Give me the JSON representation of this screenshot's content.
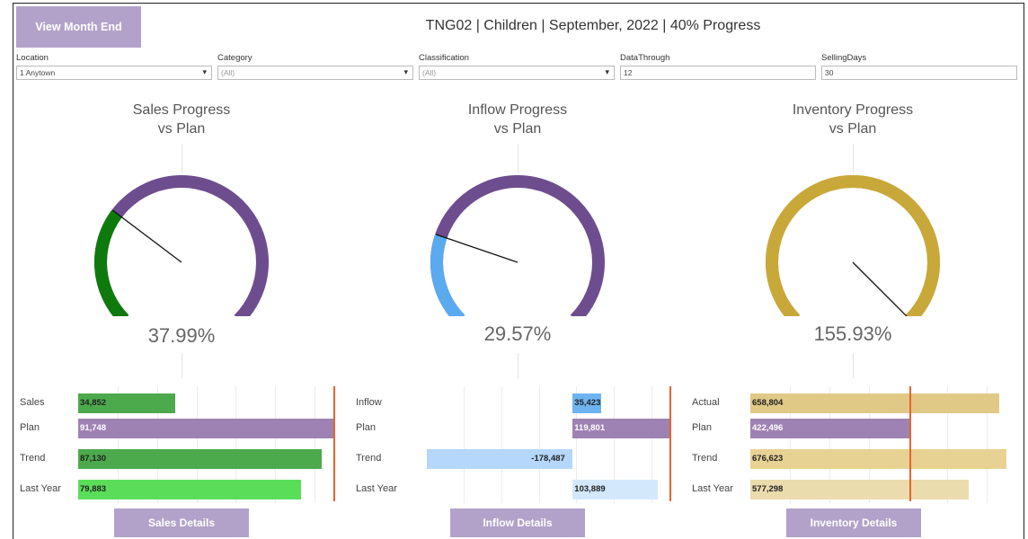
{
  "header": {
    "view_button": "View Month End",
    "title": "TNG02 | Children | September, 2022 | 40% Progress"
  },
  "filters": [
    {
      "label": "Location",
      "value": "1 Anytown",
      "type": "dropdown"
    },
    {
      "label": "Category",
      "value": "(All)",
      "type": "dropdown"
    },
    {
      "label": "Classification",
      "value": "(All)",
      "type": "dropdown"
    },
    {
      "label": "DataThrough",
      "value": "12",
      "type": "text"
    },
    {
      "label": "SellingDays",
      "value": "30",
      "type": "text"
    }
  ],
  "gauges": [
    {
      "title1": "Sales Progress",
      "title2": "vs Plan",
      "percent": "37.99%",
      "value": 37.99,
      "fill_color": "#0e7a0d",
      "track_color": "#6e4d8f"
    },
    {
      "title1": "Inflow Progress",
      "title2": "vs Plan",
      "percent": "29.57%",
      "value": 29.57,
      "fill_color": "#5aaaf0",
      "track_color": "#6e4d8f"
    },
    {
      "title1": "Inventory Progress",
      "title2": "vs Plan",
      "percent": "155.93%",
      "value": 155.93,
      "fill_color": "#c9a83a",
      "track_color": "#c9a83a"
    }
  ],
  "chart_data": [
    {
      "type": "bar",
      "categories": [
        "Sales",
        "Plan",
        "Trend",
        "Last Year"
      ],
      "values": [
        34852,
        91748,
        87130,
        79883
      ],
      "labels": [
        "34,852",
        "91,748",
        "87,130",
        "79,883"
      ],
      "colors": [
        "#4caa4c",
        "#9f82b4",
        "#4caa4c",
        "#5ade5a"
      ],
      "xlim": [
        0,
        91748
      ],
      "reference": 91748,
      "button": "Sales Details"
    },
    {
      "type": "bar",
      "categories": [
        "Inflow",
        "Plan",
        "Trend",
        "Last Year"
      ],
      "values": [
        35423,
        119801,
        -178487,
        103889
      ],
      "labels": [
        "35,423",
        "119,801",
        "-178,487",
        "103,889"
      ],
      "colors": [
        "#6fb4f0",
        "#9f82b4",
        "#b4d7fb",
        "#d4e8fc"
      ],
      "xlim": [
        -180000,
        119801
      ],
      "reference": 119801,
      "button": "Inflow Details"
    },
    {
      "type": "bar",
      "categories": [
        "Actual",
        "Plan",
        "Trend",
        "Last Year"
      ],
      "values": [
        658804,
        422496,
        676623,
        577298
      ],
      "labels": [
        "658,804",
        "422,496",
        "676,623",
        "577,298"
      ],
      "colors": [
        "#e0c887",
        "#9f82b4",
        "#e7d293",
        "#ebdcad"
      ],
      "xlim": [
        0,
        676623
      ],
      "reference": 422496,
      "button": "Inventory Details"
    }
  ]
}
